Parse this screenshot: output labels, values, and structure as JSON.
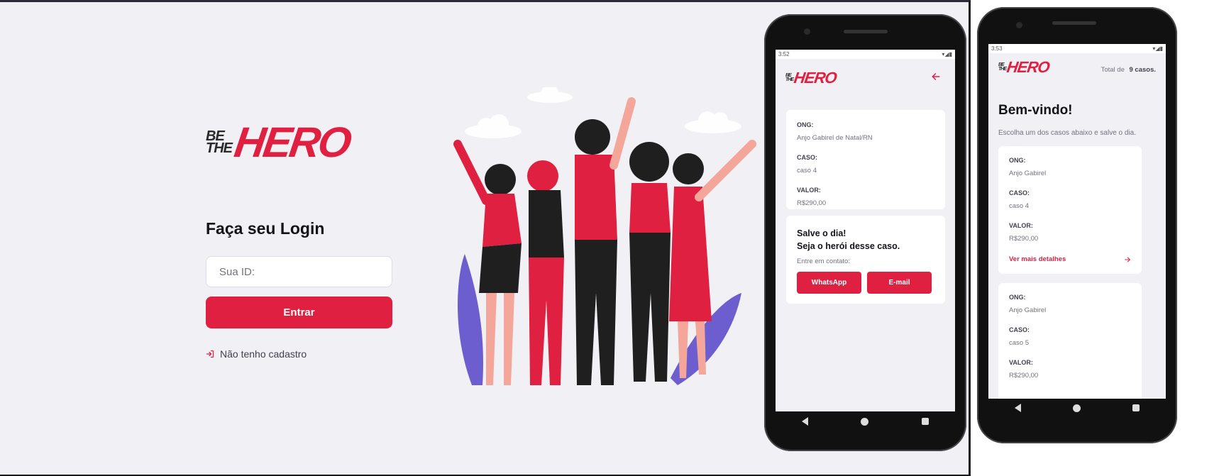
{
  "web": {
    "logo": {
      "be": "BE",
      "the": "THE",
      "hero": "HERO"
    },
    "login_title": "Faça seu Login",
    "id_placeholder": "Sua ID:",
    "enter_button": "Entrar",
    "register_link": "Não tenho cadastro"
  },
  "phone_detail": {
    "status_time": "3:52",
    "logo": {
      "be": "BE",
      "the": "THE",
      "hero": "HERO"
    },
    "incident": {
      "ong_label": "ONG:",
      "ong_value": "Anjo Gabirel de Natal/RN",
      "case_label": "CASO:",
      "case_value": "caso 4",
      "value_label": "VALOR:",
      "value_value": "R$290,00"
    },
    "contact": {
      "title_line1": "Salve o dia!",
      "title_line2": "Seja o herói desse caso.",
      "description": "Entre em contato:",
      "whatsapp_button": "WhatsApp",
      "email_button": "E-mail"
    }
  },
  "phone_list": {
    "status_time": "3:53",
    "logo": {
      "be": "BE",
      "the": "THE",
      "hero": "HERO"
    },
    "total_prefix": "Total de",
    "total_value": "9 casos.",
    "title": "Bem-vindo!",
    "description": "Escolha um dos casos abaixo e salve o dia.",
    "incidents": [
      {
        "ong_label": "ONG:",
        "ong_value": "Anjo Gabirel",
        "case_label": "CASO:",
        "case_value": "caso 4",
        "value_label": "VALOR:",
        "value_value": "R$290,00",
        "details_link": "Ver mais detalhes"
      },
      {
        "ong_label": "ONG:",
        "ong_value": "Anjo Gabirel",
        "case_label": "CASO:",
        "case_value": "caso 5",
        "value_label": "VALOR:",
        "value_value": "R$290,00"
      }
    ]
  },
  "colors": {
    "brand_red": "#e02041",
    "background": "#f0f0f5",
    "text_dark": "#13131a",
    "text_muted": "#737380"
  },
  "icons": [
    "log-in-icon",
    "arrow-left-icon",
    "arrow-right-icon"
  ]
}
